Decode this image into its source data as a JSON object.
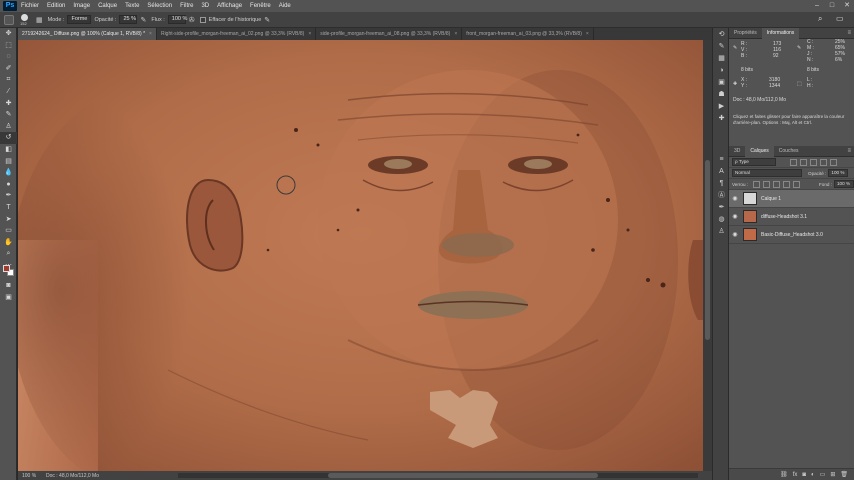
{
  "menubar": {
    "logo": "Ps",
    "items": [
      "Fichier",
      "Edition",
      "Image",
      "Calque",
      "Texte",
      "Sélection",
      "Filtre",
      "3D",
      "Affichage",
      "Fenêtre",
      "Aide"
    ],
    "minimize": "–",
    "maximize": "□",
    "close": "✕"
  },
  "options": {
    "brush_size": "152",
    "mode_label": "Mode :",
    "mode_value": "Forme",
    "opacity_label": "Opacité :",
    "opacity_value": "25 %",
    "flow_label": "Flux :",
    "flow_value": "100 %",
    "erase_history_label": "Effacer de l'historique"
  },
  "tabs": [
    {
      "label": "2719242624_ Diffuse.png @ 100% (Calque 1, RVB/8) *",
      "active": true
    },
    {
      "label": "Right-side-profile_morgan-freeman_ai_02.png @ 33,3% (RVB/8)",
      "active": false
    },
    {
      "label": "side-profile_morgan-freeman_ai_08.png @ 33,3% (RVB/8)",
      "active": false
    },
    {
      "label": "front_morgan-freeman_ai_03.png @ 33,3% (RVB/8)",
      "active": false
    }
  ],
  "tab_close": "×",
  "status": {
    "zoom": "100 %",
    "doc": "Doc : 48,0 Mo/112,0 Mo"
  },
  "info_panel": {
    "tabs": [
      "Propriétés",
      "Informations"
    ],
    "active_tab": "Informations",
    "rgb_labels": [
      "R :",
      "V :",
      "B :"
    ],
    "rgb_values": [
      "173",
      "116",
      "92"
    ],
    "cmyk_labels": [
      "C :",
      "M :",
      "J :",
      "N :"
    ],
    "cmyk_values": [
      "25%",
      "65%",
      "57%",
      "6%"
    ],
    "bits_left": "8 bits",
    "bits_right": "8 bits",
    "x_label": "X :",
    "y_label": "Y :",
    "x_value": "3180",
    "y_value": "1344",
    "w_label": "L :",
    "h_label": "H :",
    "doc": "Doc : 48,0 Mo/112,0 Mo",
    "hint": "Cliquez et faites glisser pour faire apparaître la couleur d'arrière-plan. Options : Maj, Alt et Ctrl."
  },
  "layers_panel": {
    "tabs": [
      "3D",
      "Calques",
      "Couches"
    ],
    "active_tab": "Calques",
    "filter": "ρ Type",
    "blend_mode": "Normal",
    "opacity_label": "Opacité :",
    "opacity_value": "100 %",
    "lock_label": "Verrou :",
    "fill_label": "Fond :",
    "fill_value": "100 %",
    "layers": [
      {
        "name": "Calque 1",
        "selected": true,
        "thumb_color": "#d8d8d8"
      },
      {
        "name": "diffuse-Headshot 3.1",
        "selected": false,
        "thumb_color": "#b8684a"
      },
      {
        "name": "Basic-Diffuse_Headshot 3.0",
        "selected": false,
        "thumb_color": "#c06a48"
      }
    ]
  },
  "colors": {
    "foreground": "#a33a2e",
    "background": "#ffffff",
    "skin": "#b4704e"
  }
}
